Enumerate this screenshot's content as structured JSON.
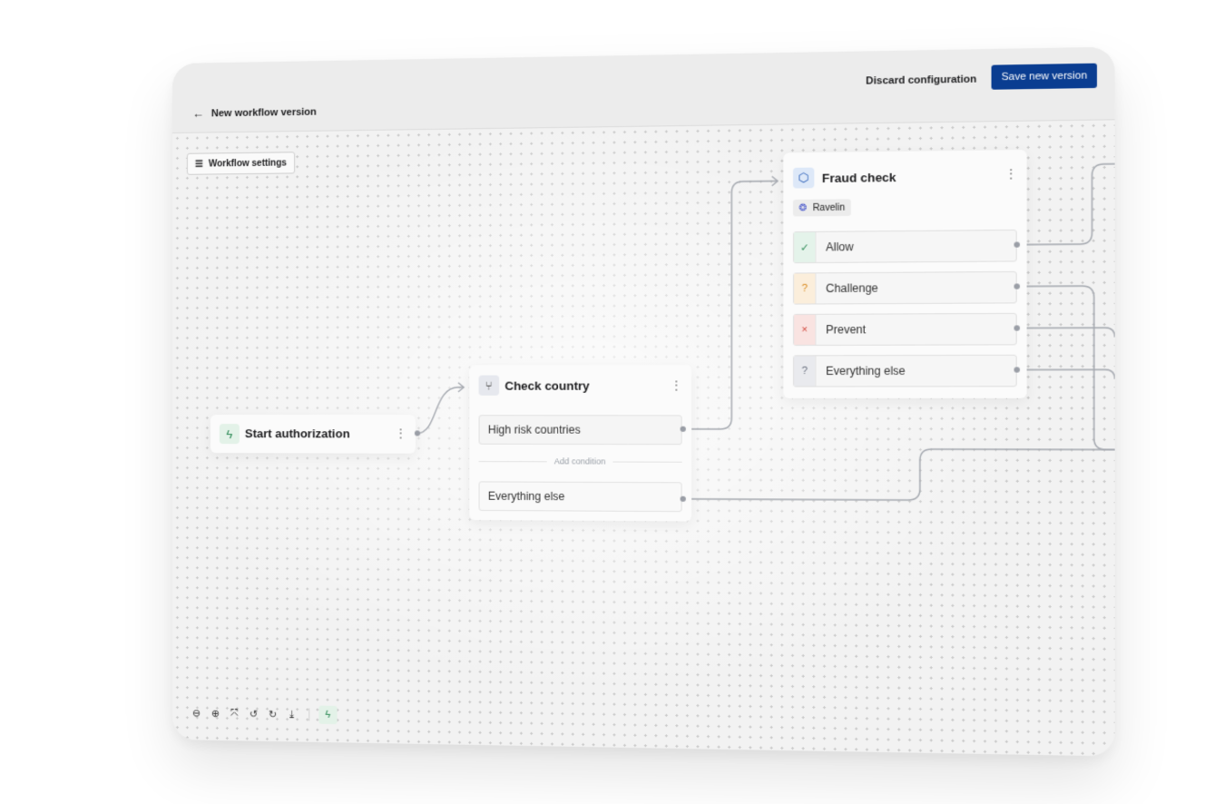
{
  "header": {
    "back_label": "New workflow version",
    "discard_label": "Discard configuration",
    "save_label": "Save new version"
  },
  "canvas": {
    "workflow_settings_label": "Workflow settings"
  },
  "nodes": {
    "start": {
      "title": "Start authorization",
      "icon": "bolt-icon"
    },
    "check_country": {
      "title": "Check country",
      "icon": "branch-icon",
      "conditions": [
        "High risk countries",
        "Everything else"
      ],
      "add_condition_label": "Add condition"
    },
    "fraud_check": {
      "title": "Fraud check",
      "icon": "cube-icon",
      "provider": "Ravelin",
      "outcomes": [
        {
          "label": "Allow",
          "symbol": "✓",
          "color": "#2e8b57",
          "bg": "#e4f3ea"
        },
        {
          "label": "Challenge",
          "symbol": "?",
          "color": "#d98a1f",
          "bg": "#fbeedb"
        },
        {
          "label": "Prevent",
          "symbol": "×",
          "color": "#d0453a",
          "bg": "#f9e3e1"
        },
        {
          "label": "Everything else",
          "symbol": "?",
          "color": "#6b7280",
          "bg": "#e9eaee"
        }
      ]
    }
  },
  "toolbar": {
    "tools": [
      "zoom-out-icon",
      "zoom-in-icon",
      "fit-view-icon",
      "undo-icon",
      "redo-icon",
      "download-icon"
    ],
    "active_tool": "bolt-icon"
  },
  "colors": {
    "primary": "#0a3d91",
    "bolt": "#2e8b57",
    "wire": "#9a9ea6"
  }
}
